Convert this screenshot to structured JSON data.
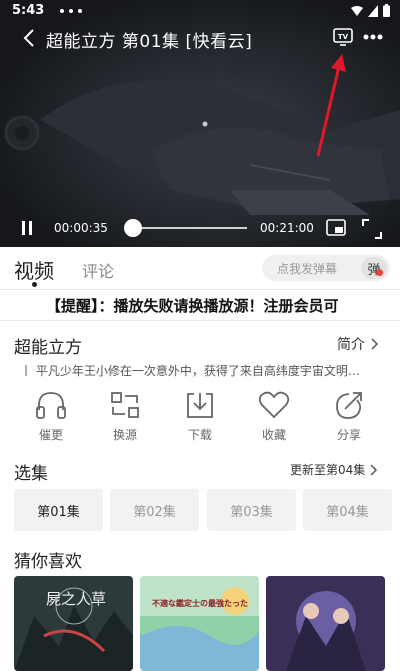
{
  "status_bar": {
    "time": "5:43"
  },
  "player": {
    "title": "超能立方 第01集 [快看云]",
    "tv_label": "TV",
    "current_time": "00:00:35",
    "duration": "00:21:00",
    "progress_fraction": 0.028
  },
  "tabs": [
    {
      "label": "视频",
      "active": true
    },
    {
      "label": "评论",
      "active": false
    }
  ],
  "danmu": {
    "placeholder": "点我发弹幕",
    "button": "弹"
  },
  "notice": "【提醒】：播放失败请换播放源！注册会员可",
  "info": {
    "title": "超能立方",
    "intro_label": "简介",
    "description": "平凡少年王小修在一次意外中，获得了来自高纬度宇宙文明…"
  },
  "actions": [
    {
      "label": "催更",
      "icon": "headphones-icon"
    },
    {
      "label": "换源",
      "icon": "switch-source-icon"
    },
    {
      "label": "下载",
      "icon": "download-icon"
    },
    {
      "label": "收藏",
      "icon": "heart-icon"
    },
    {
      "label": "分享",
      "icon": "share-icon"
    }
  ],
  "episodes": {
    "title": "选集",
    "update_text": "更新至第04集",
    "items": [
      "第01集",
      "第02集",
      "第03集",
      "第04集"
    ],
    "selected_index": 0
  },
  "recommend": {
    "title": "猜你喜欢",
    "posters": [
      {
        "text": "屍之人草"
      },
      {
        "text": "不適な鑑定士の最強たった"
      },
      {
        "text": ""
      }
    ]
  },
  "colors": {
    "accent_red": "#e8453c",
    "annotation_arrow": "#e0182d"
  }
}
